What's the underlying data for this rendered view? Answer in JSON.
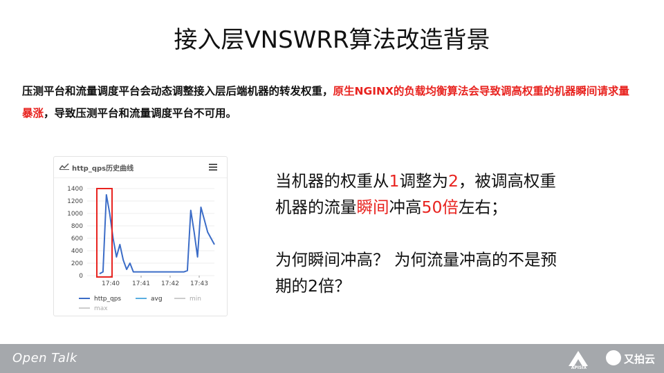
{
  "slide": {
    "title": "接入层VNSWRR算法改造背景",
    "intro": {
      "part1": "压测平台和流量调度平台会动态调整接入层后端机器的转发权重，",
      "part2": "原生NGINX的负载均衡算法会导致调高权重的机器瞬间请求量暴涨",
      "part3": "，导致压测平台和流量调度平台不可用。"
    },
    "right": {
      "line1_a": "当机器的权重从",
      "line1_b": "1",
      "line1_c": "调整为",
      "line1_d": "2",
      "line1_e": "，被调高权重",
      "line2_a": "机器的流量",
      "line2_b": "瞬间",
      "line2_c": "冲高",
      "line2_d": "50倍",
      "line2_e": "左右；",
      "q1": "为何瞬间冲高？  为何流量冲高的不是预",
      "q2": "期的2倍？"
    },
    "colors": {
      "accent_red": "#e8231f",
      "footer_bg": "#a5a8ac",
      "series_blue": "#3b6cc7",
      "series_avg": "#5aaee0",
      "series_min": "#cccccc"
    }
  },
  "chart_data": {
    "type": "line",
    "title": "http_qps历史曲线",
    "ylim": [
      0,
      1400
    ],
    "yticks": [
      "0",
      "200",
      "400",
      "600",
      "800",
      "1000",
      "1200",
      "1400"
    ],
    "xticks": [
      "17:40",
      "17:41",
      "17:42",
      "17:43"
    ],
    "series": [
      {
        "name": "http_qps",
        "values": [
          30,
          60,
          1300,
          1000,
          600,
          300,
          500,
          250,
          100,
          200,
          60,
          60,
          60,
          60,
          60,
          60,
          60,
          60,
          60,
          60,
          60,
          60,
          60,
          60,
          60,
          60,
          80,
          1050,
          700,
          300,
          1100,
          900,
          700,
          600,
          500
        ]
      },
      {
        "name": "avg",
        "values": []
      },
      {
        "name": "min",
        "values": []
      },
      {
        "name": "max",
        "values": []
      }
    ]
  },
  "footer": {
    "brand": "Open Talk",
    "logo1": "APISIX",
    "logo2": "又拍云"
  }
}
